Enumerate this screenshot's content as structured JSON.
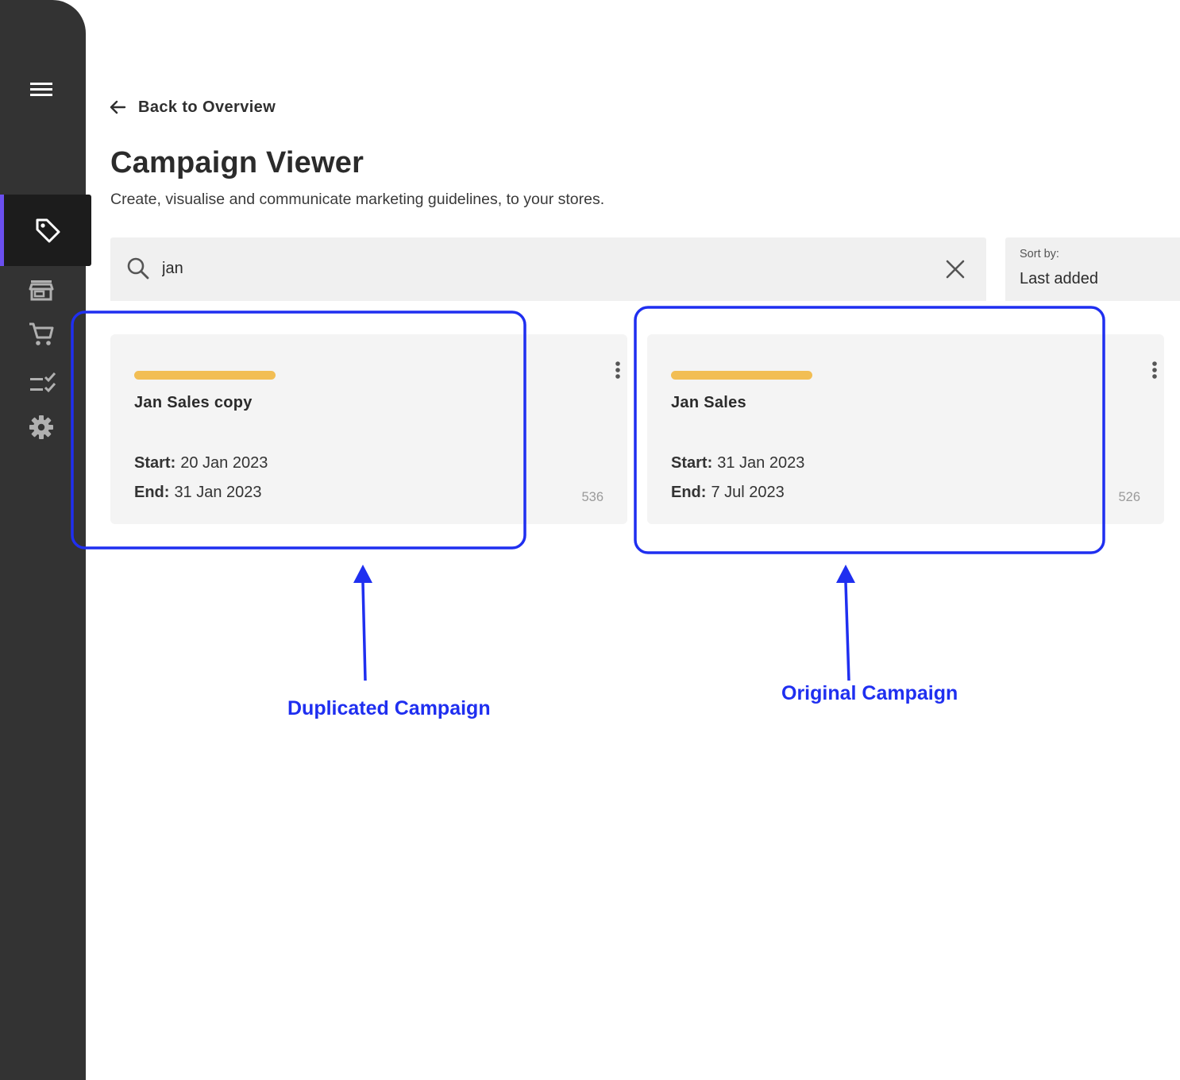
{
  "back_link": {
    "label": "Back to Overview"
  },
  "header": {
    "title": "Campaign Viewer",
    "subtitle": "Create, visualise and communicate marketing guidelines, to your stores."
  },
  "search": {
    "value": "jan"
  },
  "sort": {
    "label": "Sort by:",
    "value": "Last added"
  },
  "campaigns": [
    {
      "title": "Jan Sales copy",
      "start_label": "Start:",
      "start": "20 Jan 2023",
      "end_label": "End:",
      "end": "31 Jan 2023",
      "id": "536",
      "status_color": "#f2be54"
    },
    {
      "title": "Jan Sales",
      "start_label": "Start:",
      "start": "31 Jan 2023",
      "end_label": "End:",
      "end": "7 Jul 2023",
      "id": "526",
      "status_color": "#f2be54"
    }
  ],
  "annotations": {
    "duplicated": "Duplicated Campaign",
    "original": "Original Campaign",
    "color": "#1f2ff0"
  },
  "sidebar": {
    "active_accent": "#6b4ff0",
    "items": [
      {
        "icon": "menu-icon"
      },
      {
        "icon": "tag-icon",
        "active": true
      },
      {
        "icon": "store-icon"
      },
      {
        "icon": "shopping-cart-icon"
      },
      {
        "icon": "checklist-icon"
      },
      {
        "icon": "gear-icon"
      }
    ]
  }
}
